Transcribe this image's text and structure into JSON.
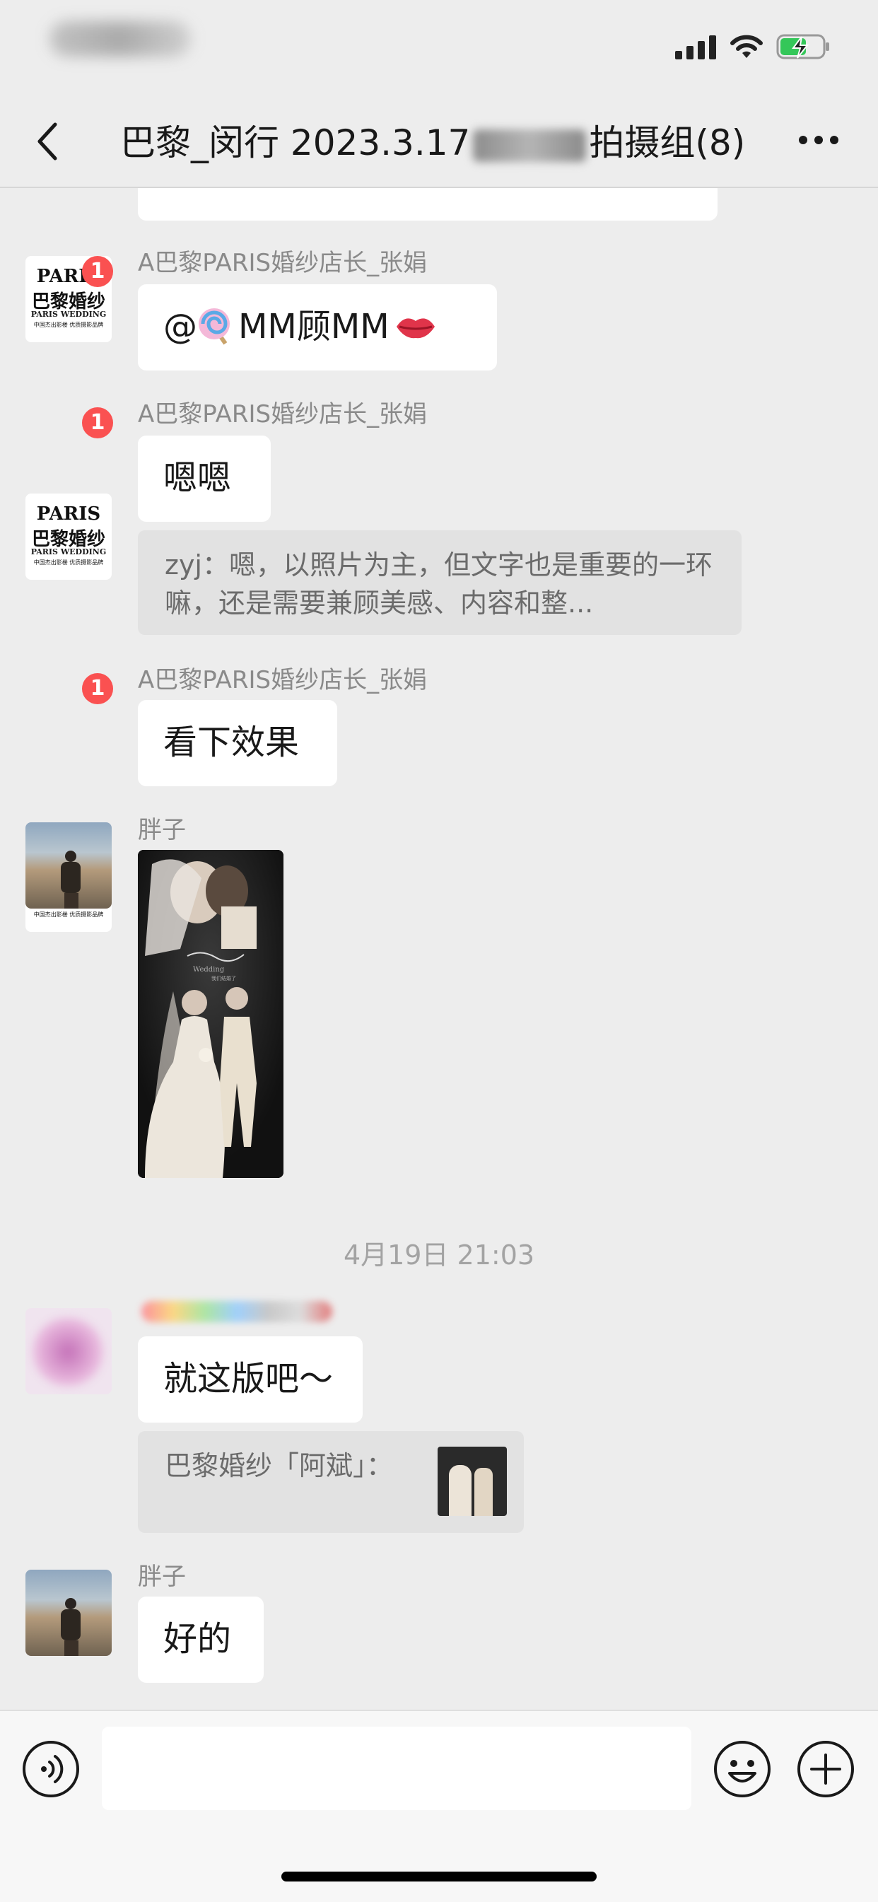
{
  "nav": {
    "title_left": "巴黎_闵行 2023.3.17",
    "title_right": "拍摄组(8)"
  },
  "avatars": {
    "paris_logo_top": "PARIS",
    "paris_logo_main": "巴黎婚纱",
    "paris_logo_sub": "PARIS WEDDING",
    "paris_logo_tagline": "中国杰出影楼  优质摄影品牌",
    "badge_count": "1"
  },
  "messages": {
    "m1": {
      "sender": "A巴黎PARIS婚纱店长_张娟",
      "text_prefix": "@",
      "text": "MM顾MM"
    },
    "m2": {
      "sender": "A巴黎PARIS婚纱店长_张娟",
      "text": "嗯嗯",
      "quote": "zyj：嗯，以照片为主，但文字也是重要的一环嘛，还是需要兼顾美感、内容和整..."
    },
    "m3": {
      "sender": "A巴黎PARIS婚纱店长_张娟",
      "text": "看下效果"
    },
    "m4": {
      "sender": "胖子",
      "image_alt": "婚纱照",
      "image_script": "Wedding",
      "image_caption": "我们结婚了"
    },
    "timestamp": "4月19日 21:03",
    "m5": {
      "text": "就这版吧～",
      "quote": "巴黎婚纱「阿斌」："
    },
    "m6": {
      "sender": "胖子",
      "text": "好的"
    }
  },
  "colors": {
    "background": "#ededed",
    "bubble": "#ffffff",
    "quote_bg": "#e2e2e2",
    "badge": "#fa5151",
    "battery_green": "#34c759"
  },
  "icons": {
    "back": "chevron-left-icon",
    "more": "more-icon",
    "voice": "voice-icon",
    "emoji": "emoji-icon",
    "add": "add-icon"
  }
}
